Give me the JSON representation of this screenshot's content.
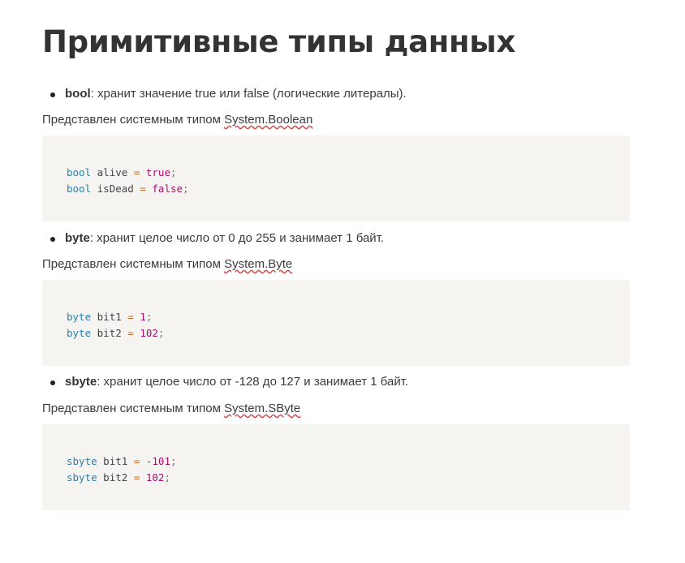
{
  "title": "Примитивные типы данных",
  "sections": [
    {
      "term": "bool",
      "description": ": хранит значение true или false (логические литералы).",
      "repr_prefix": "Представлен системным типом ",
      "system_type": "System.Boolean",
      "code": [
        {
          "type": "bool",
          "var": "alive",
          "eq": "=",
          "value": "true",
          "semi": ";"
        },
        {
          "type": "bool",
          "var": "isDead",
          "eq": "=",
          "value": "false",
          "semi": ";"
        }
      ]
    },
    {
      "term": "byte",
      "description": ": хранит целое число от 0 до 255 и занимает 1 байт.",
      "repr_prefix": "Представлен системным типом ",
      "system_type": "System.Byte",
      "code": [
        {
          "type": "byte",
          "var": "bit1",
          "eq": "=",
          "value": "1",
          "semi": ";"
        },
        {
          "type": "byte",
          "var": "bit2",
          "eq": "=",
          "value": "102",
          "semi": ";"
        }
      ]
    },
    {
      "term": "sbyte",
      "description": ": хранит целое число от -128 до 127 и занимает 1 байт.",
      "repr_prefix": "Представлен системным типом ",
      "system_type": "System.SByte",
      "code": [
        {
          "type": "sbyte",
          "var": "bit1",
          "eq": "=",
          "value": "-101",
          "semi": ";"
        },
        {
          "type": "sbyte",
          "var": "bit2",
          "eq": "=",
          "value": "102",
          "semi": ";"
        }
      ]
    }
  ]
}
